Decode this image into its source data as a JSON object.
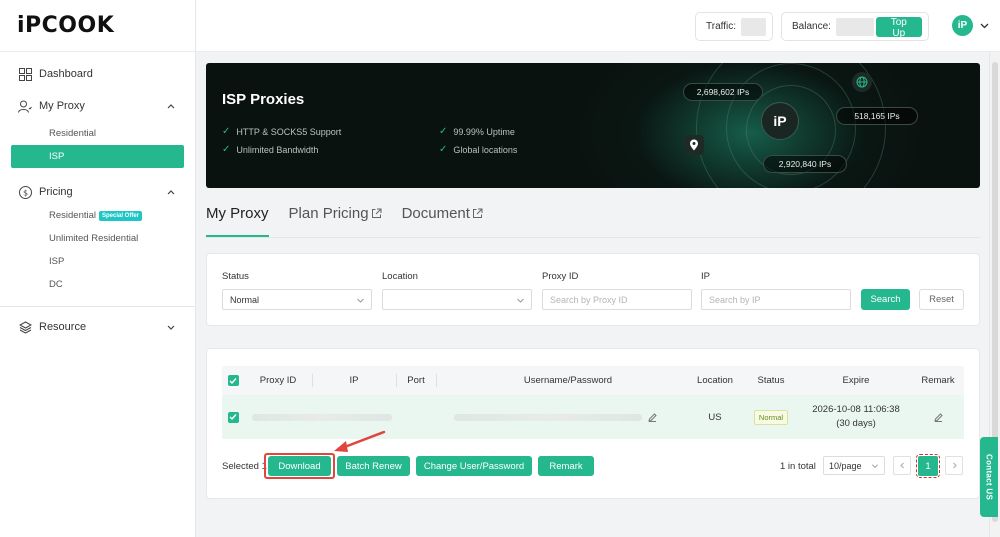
{
  "brand": {
    "logo_text": "iPCOOK"
  },
  "sidebar": {
    "dashboard": "Dashboard",
    "my_proxy": {
      "label": "My Proxy",
      "items": [
        "Residential",
        "ISP"
      ],
      "active": "ISP"
    },
    "pricing": {
      "label": "Pricing",
      "items": [
        {
          "label": "Residential",
          "badge": "Special Offer"
        },
        {
          "label": "Unlimited Residential"
        },
        {
          "label": "ISP"
        },
        {
          "label": "DC"
        }
      ]
    },
    "resource": "Resource"
  },
  "topbar": {
    "traffic_label": "Traffic:",
    "balance_label": "Balance:",
    "topup_label": "Top Up",
    "avatar_text": "iP"
  },
  "banner": {
    "title": "ISP Proxies",
    "features": [
      "HTTP & SOCKS5 Support",
      "Unlimited Bandwidth",
      "99.99% Uptime",
      "Global locations"
    ],
    "ip_counts": [
      "2,698,602 IPs",
      "518,165 IPs",
      "2,920,840 IPs"
    ],
    "center_logo": "iP"
  },
  "tabs": [
    {
      "label": "My Proxy",
      "active": true
    },
    {
      "label": "Plan Pricing",
      "external": true
    },
    {
      "label": "Document",
      "external": true
    }
  ],
  "filters": {
    "status_label": "Status",
    "status_value": "Normal",
    "location_label": "Location",
    "location_value": "",
    "proxy_id_label": "Proxy ID",
    "proxy_id_placeholder": "Search by Proxy ID",
    "ip_label": "IP",
    "ip_placeholder": "Search by IP",
    "search_label": "Search",
    "reset_label": "Reset"
  },
  "table": {
    "headers": [
      "Proxy ID",
      "IP",
      "Port",
      "Username/Password",
      "Location",
      "Status",
      "Expire",
      "Remark"
    ],
    "rows": [
      {
        "location": "US",
        "status": "Normal",
        "expire_date": "2026-10-08 11:06:38",
        "expire_days": "(30 days)"
      }
    ]
  },
  "actions": {
    "selected_text": "Selected 1",
    "download": "Download",
    "batch_renew": "Batch Renew",
    "change_user_password": "Change User/Password",
    "remark": "Remark"
  },
  "pagination": {
    "total_text": "1 in total",
    "page_size": "10/page",
    "current_page": "1"
  },
  "contact": "Contact US",
  "colors": {
    "accent": "#25b88f",
    "banner_bg": "#0a1210",
    "highlight": "#e0463d"
  }
}
